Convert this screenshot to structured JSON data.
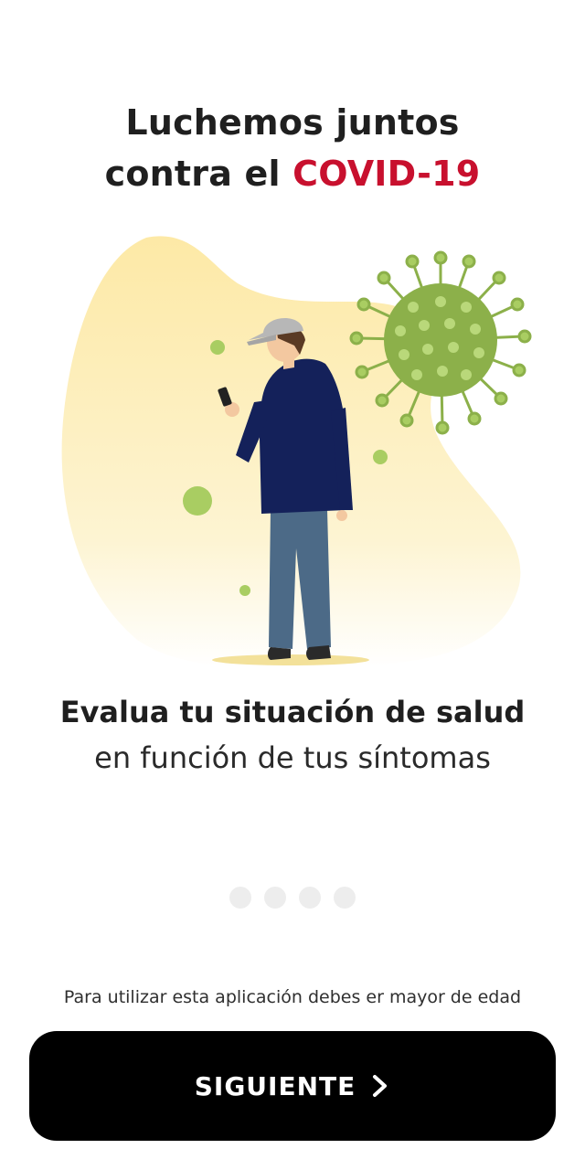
{
  "header": {
    "title_line1": "Luchemos juntos",
    "title_line2_prefix": "contra el",
    "title_line2_accent": "COVID-19"
  },
  "illustration": {
    "icon": "person-with-phone-and-virus-illustration"
  },
  "content": {
    "headline": "Evalua tu situación de salud",
    "subline": "en función de tus síntomas"
  },
  "pager": {
    "count": 4,
    "active_index": 0
  },
  "footer": {
    "notice": "Para utilizar esta aplicación debes er mayor de edad",
    "button_label": "SIGUIENTE",
    "button_icon": "chevron-right-icon"
  },
  "colors": {
    "accent": "#c8102e",
    "button_bg": "#000000",
    "virus_green": "#8cb04a",
    "blob_yellow": "#fdf0b8"
  }
}
